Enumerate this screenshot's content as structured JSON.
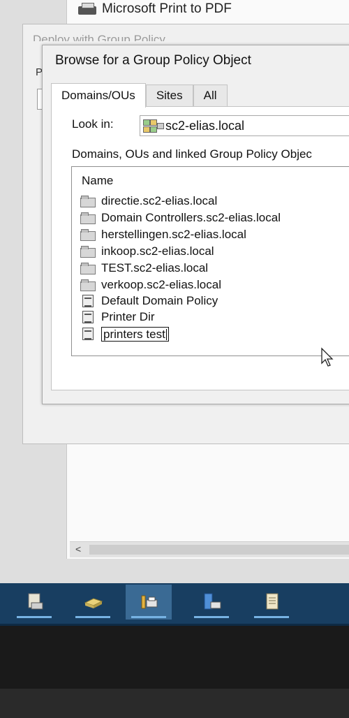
{
  "background": {
    "printer_item": "Microsoft Print to PDF",
    "scroll_left_arrow": "<"
  },
  "deploy_dialog": {
    "title": "Deploy with Group Policy",
    "partial_label": "P"
  },
  "browse_dialog": {
    "title": "Browse for a Group Policy Object",
    "tabs": [
      {
        "label": "Domains/OUs",
        "active": true
      },
      {
        "label": "Sites",
        "active": false
      },
      {
        "label": "All",
        "active": false
      }
    ],
    "look_in_label": "Look in:",
    "look_in_value": "sc2-elias.local",
    "list_caption": "Domains, OUs and linked Group Policy Objec",
    "list_column": "Name",
    "items": [
      {
        "name": "directie.sc2-elias.local",
        "icon": "folder-icon"
      },
      {
        "name": "Domain Controllers.sc2-elias.local",
        "icon": "folder-icon"
      },
      {
        "name": "herstellingen.sc2-elias.local",
        "icon": "folder-icon"
      },
      {
        "name": "inkoop.sc2-elias.local",
        "icon": "folder-icon"
      },
      {
        "name": "TEST.sc2-elias.local",
        "icon": "folder-icon"
      },
      {
        "name": "verkoop.sc2-elias.local",
        "icon": "folder-icon"
      },
      {
        "name": "Default Domain Policy",
        "icon": "gpo-icon"
      },
      {
        "name": "Printer Dir",
        "icon": "gpo-icon"
      },
      {
        "name": "printers test",
        "icon": "gpo-icon",
        "editing": true
      }
    ]
  },
  "taskbar": {
    "buttons": [
      {
        "icon": "print-server-icon",
        "active": false
      },
      {
        "icon": "printer-icon",
        "active": false
      },
      {
        "icon": "print-management-icon",
        "active": true
      },
      {
        "icon": "network-printers-icon",
        "active": false
      },
      {
        "icon": "document-icon",
        "active": false
      }
    ]
  },
  "colors": {
    "taskbar": "#183e61",
    "taskbar_active": "#3a6a94",
    "taskbar_underline": "#77b2e3",
    "dialog_bg": "#f0f0f0"
  }
}
